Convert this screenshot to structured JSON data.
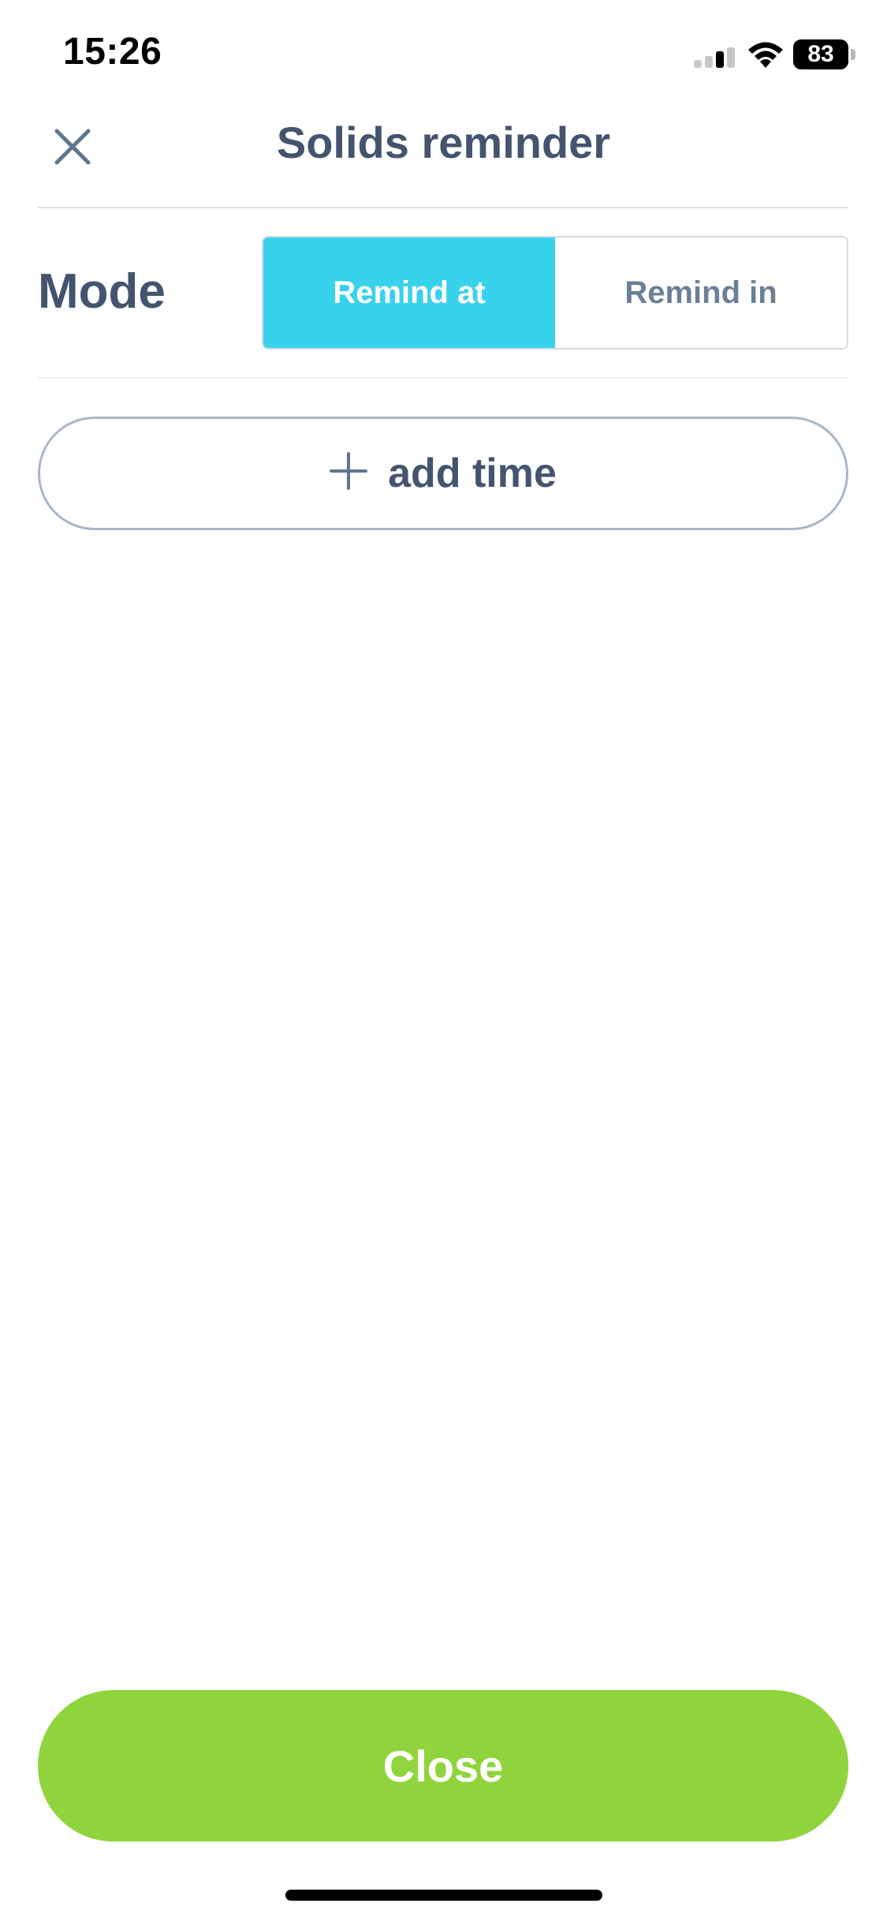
{
  "status_bar": {
    "time": "15:26",
    "battery_level": "83",
    "icons": [
      "signal-icon",
      "wifi-icon",
      "battery-icon"
    ]
  },
  "header": {
    "title": "Solids reminder",
    "close_icon": "close-icon"
  },
  "mode": {
    "label": "Mode",
    "options": [
      "Remind at",
      "Remind in"
    ],
    "selected": "Remind at"
  },
  "add_time": {
    "icon": "plus-icon",
    "label": "add time"
  },
  "footer": {
    "close_label": "Close"
  },
  "colors": {
    "accent": "#38d2ec",
    "primary_button": "#8fd43d",
    "text": "#44546f",
    "muted_text": "#6b7f97"
  }
}
